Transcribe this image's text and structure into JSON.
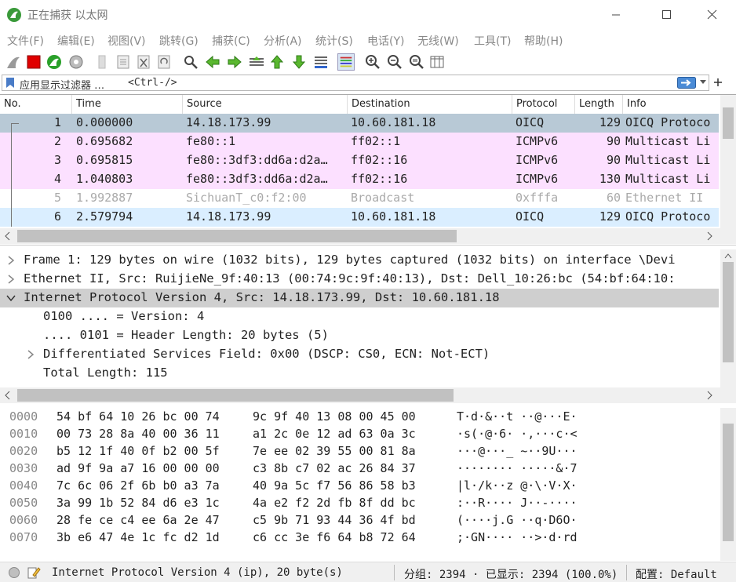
{
  "window": {
    "title": "正在捕获 以太网"
  },
  "menu": [
    "文件(F)",
    "编辑(E)",
    "视图(V)",
    "跳转(G)",
    "捕获(C)",
    "分析(A)",
    "统计(S)",
    "电话(Y)",
    "无线(W)",
    "工具(T)",
    "帮助(H)"
  ],
  "filter": {
    "placeholder": "应用显示过滤器 …",
    "shortcut": "<Ctrl-/>"
  },
  "packet_list": {
    "columns": [
      "No.",
      "Time",
      "Source",
      "Destination",
      "Protocol",
      "Length",
      "Info"
    ],
    "rows": [
      {
        "no": "1",
        "time": "0.000000",
        "src": "14.18.173.99",
        "dst": "10.60.181.18",
        "proto": "OICQ",
        "len": "129",
        "info": "OICQ Protoco",
        "bg": "#b8c9d6",
        "fg": "#222222"
      },
      {
        "no": "2",
        "time": "0.695682",
        "src": "fe80::1",
        "dst": "ff02::1",
        "proto": "ICMPv6",
        "len": "90",
        "info": "Multicast Li",
        "bg": "#fce0ff",
        "fg": "#222222"
      },
      {
        "no": "3",
        "time": "0.695815",
        "src": "fe80::3df3:dd6a:d2a…",
        "dst": "ff02::16",
        "proto": "ICMPv6",
        "len": "90",
        "info": "Multicast Li",
        "bg": "#fce0ff",
        "fg": "#222222"
      },
      {
        "no": "4",
        "time": "1.040803",
        "src": "fe80::3df3:dd6a:d2a…",
        "dst": "ff02::16",
        "proto": "ICMPv6",
        "len": "130",
        "info": "Multicast Li",
        "bg": "#fce0ff",
        "fg": "#222222"
      },
      {
        "no": "5",
        "time": "1.992887",
        "src": "SichuanT_c0:f2:00",
        "dst": "Broadcast",
        "proto": "0xfffa",
        "len": "60",
        "info": "Ethernet II",
        "bg": "#ffffff",
        "fg": "#aaaaaa"
      },
      {
        "no": "6",
        "time": "2.579794",
        "src": "14.18.173.99",
        "dst": "10.60.181.18",
        "proto": "OICQ",
        "len": "129",
        "info": "OICQ Protoco",
        "bg": "#daeeff",
        "fg": "#222222"
      }
    ]
  },
  "details": [
    {
      "indent": 0,
      "arrow": ">",
      "text": "Frame 1: 129 bytes on wire (1032 bits), 129 bytes captured (1032 bits) on interface \\Devi",
      "selected": false
    },
    {
      "indent": 0,
      "arrow": ">",
      "text": "Ethernet II, Src: RuijieNe_9f:40:13 (00:74:9c:9f:40:13), Dst: Dell_10:26:bc (54:bf:64:10:",
      "selected": false
    },
    {
      "indent": 0,
      "arrow": "v",
      "text": "Internet Protocol Version 4, Src: 14.18.173.99, Dst: 10.60.181.18",
      "selected": true
    },
    {
      "indent": 1,
      "arrow": "",
      "text": "0100 .... = Version: 4",
      "selected": false
    },
    {
      "indent": 1,
      "arrow": "",
      "text": ".... 0101 = Header Length: 20 bytes (5)",
      "selected": false
    },
    {
      "indent": 1,
      "arrow": ">",
      "text": "Differentiated Services Field: 0x00 (DSCP: CS0, ECN: Not-ECT)",
      "selected": false
    },
    {
      "indent": 1,
      "arrow": "",
      "text": "Total Length: 115",
      "selected": false
    }
  ],
  "hex": [
    {
      "off": "0000",
      "b1": "54 bf 64 10 26 bc 00 74",
      "b2": "9c 9f 40 13 08 00 45 00",
      "ascii": "T·d·&··t ··@···E·"
    },
    {
      "off": "0010",
      "b1": "00 73 28 8a 40 00 36 11",
      "b2": "a1 2c 0e 12 ad 63 0a 3c",
      "ascii": "·s(·@·6· ·,···c·<"
    },
    {
      "off": "0020",
      "b1": "b5 12 1f 40 0f b2 00 5f",
      "b2": "7e ee 02 39 55 00 81 8a",
      "ascii": "···@···_ ~··9U···"
    },
    {
      "off": "0030",
      "b1": "ad 9f 9a a7 16 00 00 00",
      "b2": "c3 8b c7 02 ac 26 84 37",
      "ascii": "········ ·····&·7"
    },
    {
      "off": "0040",
      "b1": "7c 6c 06 2f 6b b0 a3 7a",
      "b2": "40 9a 5c f7 56 86 58 b3",
      "ascii": "|l·/k··z @·\\·V·X·"
    },
    {
      "off": "0050",
      "b1": "3a 99 1b 52 84 d6 e3 1c",
      "b2": "4a e2 f2 2d fb 8f dd bc",
      "ascii": ":··R···· J··-····"
    },
    {
      "off": "0060",
      "b1": "28 fe ce c4 ee 6a 2e 47",
      "b2": "c5 9b 71 93 44 36 4f bd",
      "ascii": "(····j.G ··q·D6O·"
    },
    {
      "off": "0070",
      "b1": "3b e6 47 4e 1c fc d2 1d",
      "b2": "c6 cc 3e f6 64 b8 72 64",
      "ascii": ";·GN···· ··>·d·rd"
    }
  ],
  "status": {
    "text": "Internet Protocol Version 4 (ip), 20 byte(s)",
    "packets": "分组: 2394 · 已显示: 2394 (100.0%)",
    "profile": "配置: Default"
  }
}
